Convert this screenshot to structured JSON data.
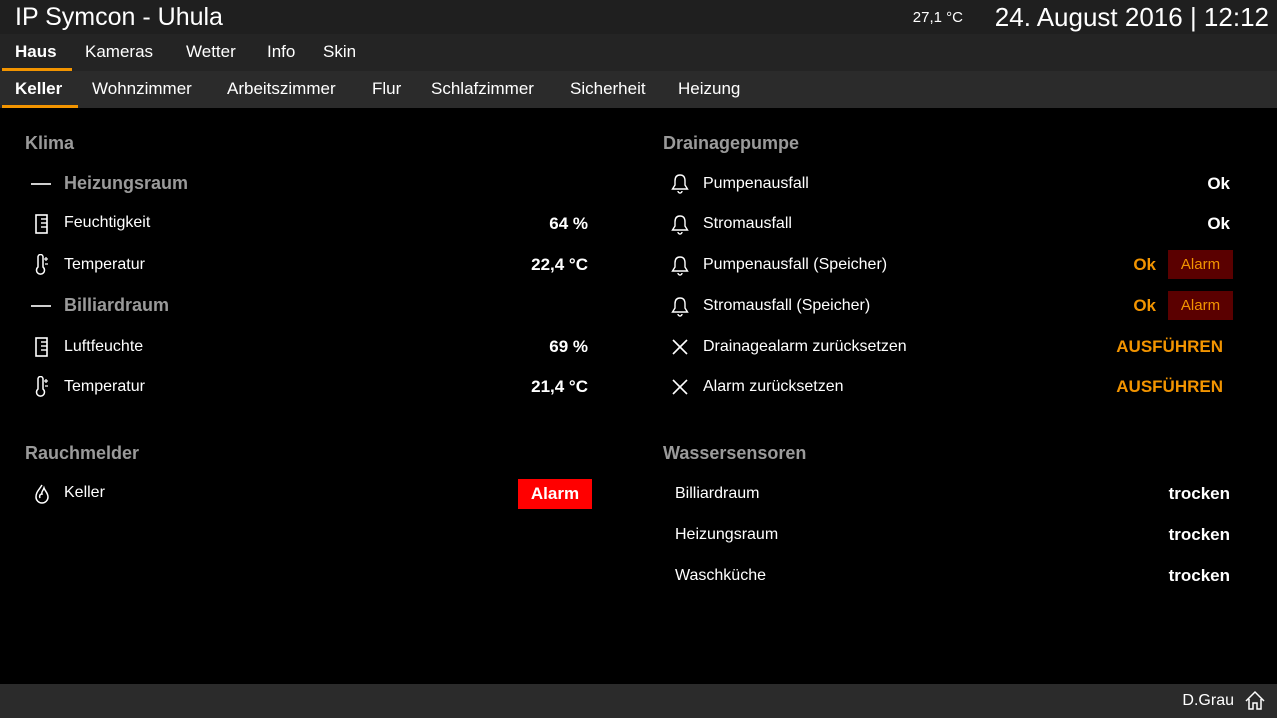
{
  "header": {
    "title": "IP Symcon - Uhula",
    "outside_temp": "27,1 °C",
    "datetime": "24. August 2016 | 12:12"
  },
  "main_nav": {
    "tabs": [
      "Haus",
      "Kameras",
      "Wetter",
      "Info",
      "Skin"
    ],
    "active": "Haus"
  },
  "sub_nav": {
    "tabs": [
      "Keller",
      "Wohnzimmer",
      "Arbeitszimmer",
      "Flur",
      "Schlafzimmer",
      "Sicherheit",
      "Heizung"
    ],
    "active": "Keller"
  },
  "klima": {
    "title": "Klima",
    "groups": [
      {
        "name": "Heizungsraum",
        "rows": [
          {
            "label": "Feuchtigkeit",
            "value": "64 %",
            "icon": "humidity-icon"
          },
          {
            "label": "Temperatur",
            "value": "22,4 °C",
            "icon": "thermometer-icon"
          }
        ]
      },
      {
        "name": "Billiardraum",
        "rows": [
          {
            "label": "Luftfeuchte",
            "value": "69 %",
            "icon": "humidity-icon"
          },
          {
            "label": "Temperatur",
            "value": "21,4 °C",
            "icon": "thermometer-icon"
          }
        ]
      }
    ]
  },
  "rauchmelder": {
    "title": "Rauchmelder",
    "rows": [
      {
        "label": "Keller",
        "value": "Alarm",
        "icon": "flame-icon"
      }
    ]
  },
  "drainagepumpe": {
    "title": "Drainagepumpe",
    "rows": [
      {
        "label": "Pumpenausfall",
        "value": "Ok",
        "icon": "bell-icon"
      },
      {
        "label": "Stromausfall",
        "value": "Ok",
        "icon": "bell-icon"
      },
      {
        "label": "Pumpenausfall (Speicher)",
        "value": "Ok",
        "button": "Alarm",
        "icon": "bell-icon"
      },
      {
        "label": "Stromausfall (Speicher)",
        "value": "Ok",
        "button": "Alarm",
        "icon": "bell-icon"
      },
      {
        "label": "Drainagealarm zurücksetzen",
        "action": "AUSFÜHREN",
        "icon": "close-icon"
      },
      {
        "label": "Alarm zurücksetzen",
        "action": "AUSFÜHREN",
        "icon": "close-icon"
      }
    ]
  },
  "wassersensoren": {
    "title": "Wassersensoren",
    "rows": [
      {
        "label": "Billiardraum",
        "value": "trocken"
      },
      {
        "label": "Heizungsraum",
        "value": "trocken"
      },
      {
        "label": "Waschküche",
        "value": "trocken"
      }
    ]
  },
  "footer": {
    "user": "D.Grau"
  },
  "colors": {
    "accent": "#f29400",
    "alarm_red": "#ff0000",
    "alarm_dark": "#5a0000"
  }
}
